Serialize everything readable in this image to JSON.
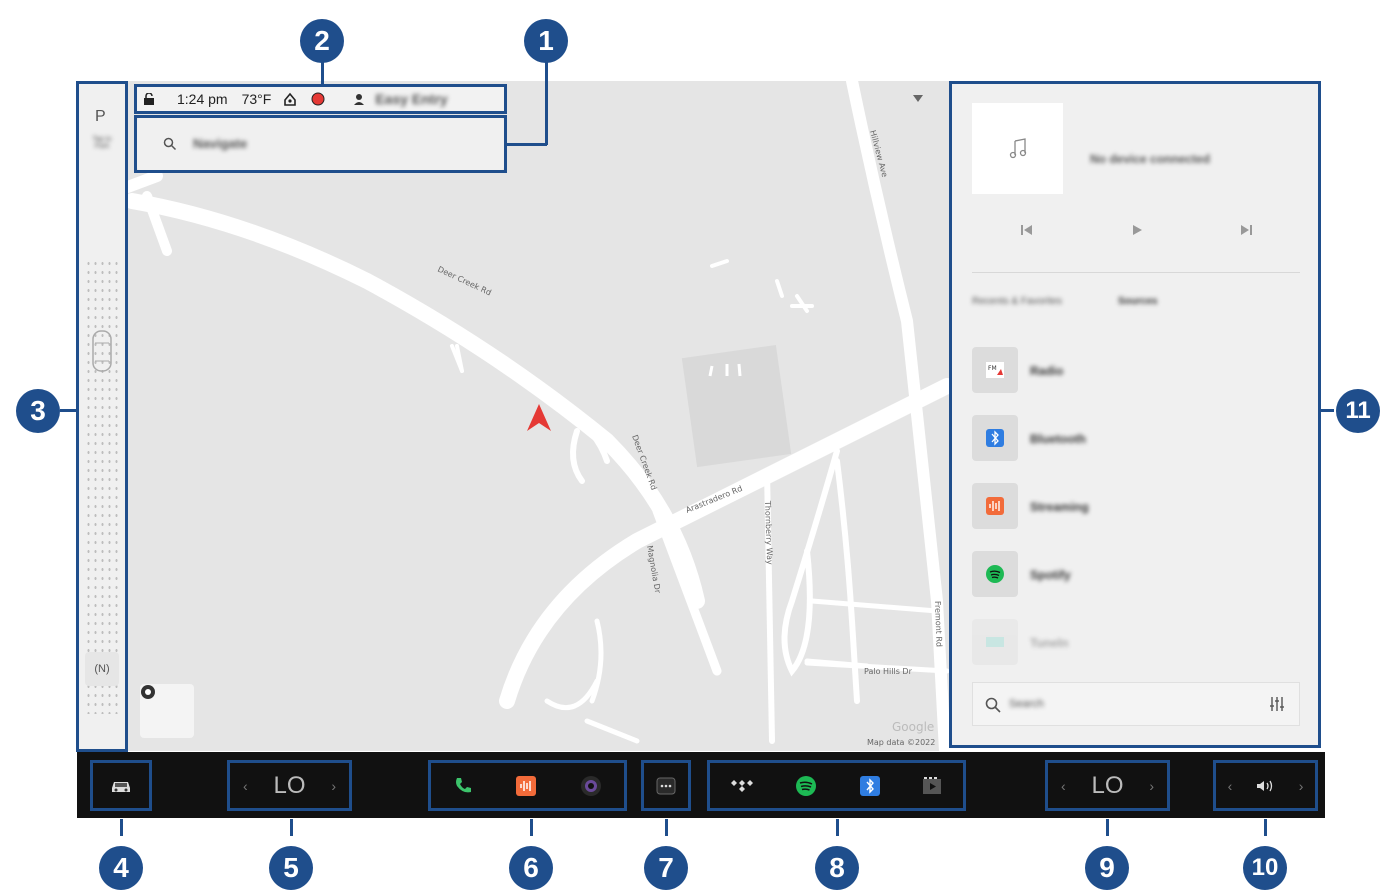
{
  "status_bar": {
    "time": "1:24 pm",
    "temperature": "73°F",
    "profile": "Easy Entry"
  },
  "search": {
    "placeholder": "Navigate"
  },
  "left_strip": {
    "gear": "P",
    "hint": "Tap to Park",
    "mode": "(N)"
  },
  "map": {
    "streets": [
      "Deer Creek Rd",
      "Deer Creek Rd",
      "Arastradero Rd",
      "Hillview Ave",
      "Thornberry Way",
      "Magnolia Dr",
      "Fremont Rd",
      "Palo Hills Dr"
    ],
    "attribution": "Map data ©2022",
    "provider": "Google"
  },
  "media": {
    "status": "No device connected",
    "tabs": [
      "Recents & Favorites",
      "Sources"
    ],
    "sources": [
      "Radio",
      "Bluetooth",
      "Streaming",
      "Spotify",
      "Tuneln"
    ],
    "search_placeholder": "Search"
  },
  "climate": {
    "driver_temp": "LO",
    "passenger_temp": "LO"
  },
  "callouts": [
    "1",
    "2",
    "3",
    "4",
    "5",
    "6",
    "7",
    "8",
    "9",
    "10",
    "11"
  ],
  "colors": {
    "callout": "#1f4e8c",
    "nav_arrow": "#e53935",
    "phone": "#3cc36b",
    "spotify": "#1db954",
    "bluetooth": "#2f7de1",
    "streaming": "#f26b3a"
  }
}
